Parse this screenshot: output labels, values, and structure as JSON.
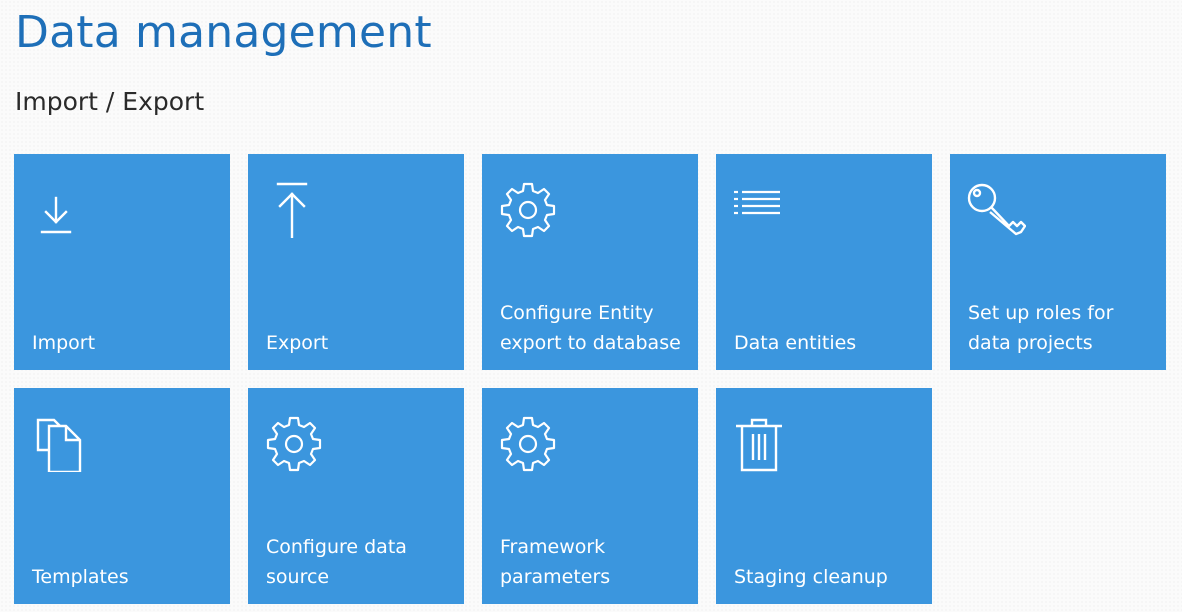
{
  "page": {
    "title": "Data management",
    "section": "Import / Export"
  },
  "colors": {
    "title": "#1e6fb8",
    "tile_background": "#3b96de",
    "tile_text": "#ffffff"
  },
  "tiles": [
    {
      "label": "Import",
      "icon": "download-icon"
    },
    {
      "label": "Export",
      "icon": "upload-icon"
    },
    {
      "label": "Configure Entity export to database",
      "icon": "gear-icon"
    },
    {
      "label": "Data entities",
      "icon": "list-icon"
    },
    {
      "label": "Set up roles for data projects",
      "icon": "key-icon"
    },
    {
      "label": "Templates",
      "icon": "copy-icon"
    },
    {
      "label": "Configure data source",
      "icon": "gear-icon"
    },
    {
      "label": "Framework parameters",
      "icon": "gear-icon"
    },
    {
      "label": "Staging cleanup",
      "icon": "trash-icon"
    }
  ]
}
